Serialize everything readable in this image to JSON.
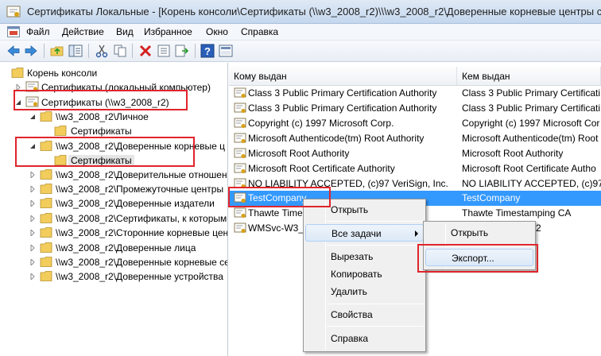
{
  "window": {
    "title": "Сертификаты Локальные - [Корень консоли\\Сертификаты (\\\\w3_2008_r2)\\\\\\w3_2008_r2\\Доверенные корневые центры сертифика"
  },
  "menubar": {
    "items": [
      "Файл",
      "Действие",
      "Вид",
      "Избранное",
      "Окно",
      "Справка"
    ]
  },
  "toolbar": {
    "buttons": [
      "back-icon",
      "forward-icon",
      "up-folder-icon",
      "show-tree-icon",
      "cut-icon",
      "copy-icon",
      "delete-icon",
      "properties-icon",
      "export-list-icon",
      "help-icon",
      "view-icon"
    ]
  },
  "tree": {
    "items": [
      {
        "label": "Корень консоли"
      },
      {
        "label": "Сертификаты (локальный компьютер)"
      },
      {
        "label": "Сертификаты (\\\\w3_2008_r2)"
      },
      {
        "label": "\\\\w3_2008_r2\\Личное"
      },
      {
        "label": "Сертификаты"
      },
      {
        "label": "\\\\w3_2008_r2\\Доверенные корневые ц"
      },
      {
        "label": "Сертификаты"
      },
      {
        "label": "\\\\w3_2008_r2\\Доверительные отношен"
      },
      {
        "label": "\\\\w3_2008_r2\\Промежуточные центры"
      },
      {
        "label": "\\\\w3_2008_r2\\Доверенные издатели"
      },
      {
        "label": "\\\\w3_2008_r2\\Сертификаты, к которым"
      },
      {
        "label": "\\\\w3_2008_r2\\Сторонние корневые цен"
      },
      {
        "label": "\\\\w3_2008_r2\\Доверенные лица"
      },
      {
        "label": "\\\\w3_2008_r2\\Доверенные корневые се"
      },
      {
        "label": "\\\\w3_2008_r2\\Доверенные устройства"
      }
    ]
  },
  "list": {
    "columns": [
      "Кому выдан",
      "Кем выдан"
    ],
    "rows": [
      {
        "issued_to": "Class 3 Public Primary Certification Authority",
        "issued_by": "Class 3 Public Primary Certificati"
      },
      {
        "issued_to": "Class 3 Public Primary Certification Authority",
        "issued_by": "Class 3 Public Primary Certificati"
      },
      {
        "issued_to": "Copyright (c) 1997 Microsoft Corp.",
        "issued_by": "Copyright (c) 1997 Microsoft Cor"
      },
      {
        "issued_to": "Microsoft Authenticode(tm) Root Authority",
        "issued_by": "Microsoft Authenticode(tm) Root"
      },
      {
        "issued_to": "Microsoft Root Authority",
        "issued_by": "Microsoft Root Authority"
      },
      {
        "issued_to": "Microsoft Root Certificate Authority",
        "issued_by": "Microsoft Root Certificate Autho"
      },
      {
        "issued_to": "NO LIABILITY ACCEPTED, (c)97 VeriSign, Inc.",
        "issued_by": "NO LIABILITY ACCEPTED, (c)97 V"
      },
      {
        "issued_to": "TestCompany",
        "issued_by": "TestCompany"
      },
      {
        "issued_to": "Thawte Time",
        "issued_by": "Thawte Timestamping CA"
      },
      {
        "issued_to": "WMSvc-W3_2",
        "issued_by": "2"
      }
    ]
  },
  "context_menu": {
    "items": [
      "Открыть",
      "Все задачи",
      "Вырезать",
      "Копировать",
      "Удалить",
      "Свойства",
      "Справка"
    ]
  },
  "submenu": {
    "items": [
      "Открыть",
      "Экспорт..."
    ]
  },
  "colors": {
    "selection": "#3399ff",
    "annotation": "#e0252c",
    "folder": "#f2cd5c"
  }
}
